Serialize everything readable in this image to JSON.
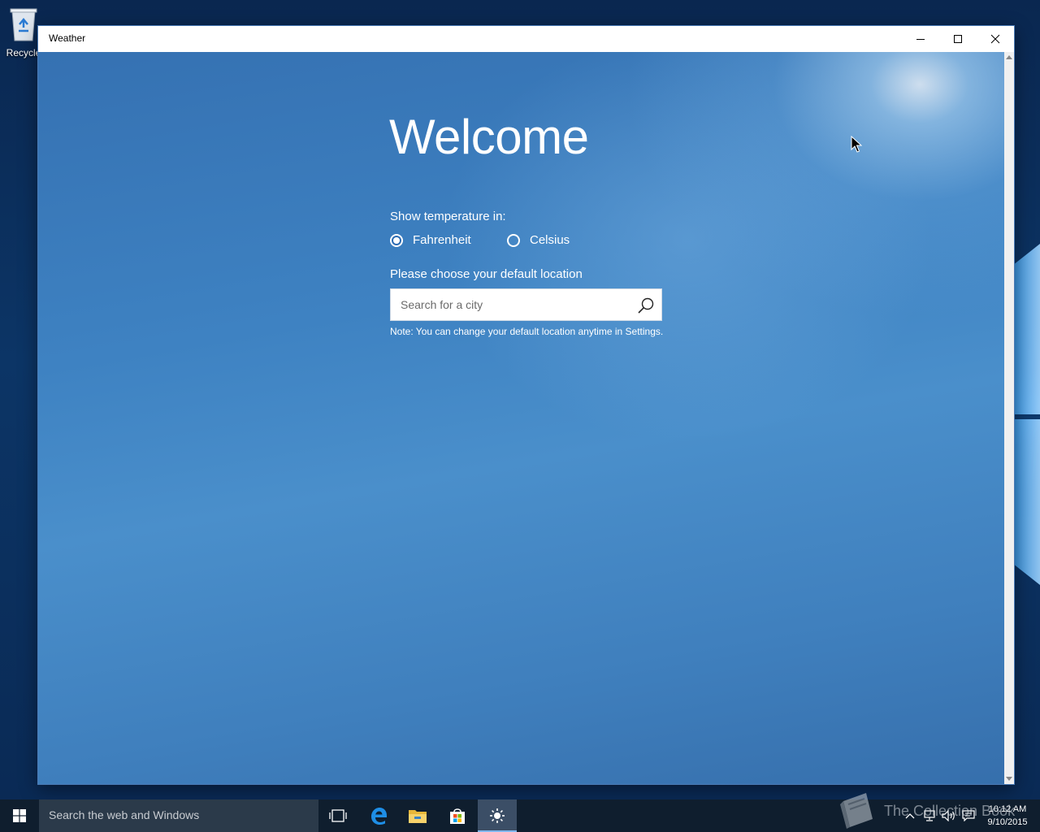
{
  "desktop": {
    "icons": [
      {
        "label": "Recycle",
        "icon": "recycle-bin-icon"
      }
    ]
  },
  "window": {
    "title": "Weather",
    "controls": {
      "minimize": "minimize-icon",
      "maximize": "maximize-icon",
      "close": "close-icon"
    }
  },
  "app": {
    "heading": "Welcome",
    "temperature_label": "Show temperature in:",
    "units": [
      {
        "label": "Fahrenheit",
        "selected": true
      },
      {
        "label": "Celsius",
        "selected": false
      }
    ],
    "location_label": "Please choose your default location",
    "search": {
      "placeholder": "Search for a city",
      "value": "",
      "icon": "search-icon"
    },
    "note": "Note: You can change your default location anytime in Settings."
  },
  "taskbar": {
    "search_placeholder": "Search the web and Windows",
    "pinned": [
      "task-view-icon",
      "edge-icon",
      "file-explorer-icon",
      "store-icon",
      "weather-icon"
    ],
    "active": "weather-icon",
    "tray": [
      "chevron-up-icon",
      "network-icon",
      "volume-icon",
      "action-center-icon"
    ],
    "clock": {
      "time": "10:12 AM",
      "date": "9/10/2015"
    }
  },
  "watermark": {
    "text": "The Collection Book"
  },
  "colors": {
    "accent": "#2a6bb3",
    "taskbar": "#0f1e2e",
    "app_background": "#3e82c2"
  }
}
